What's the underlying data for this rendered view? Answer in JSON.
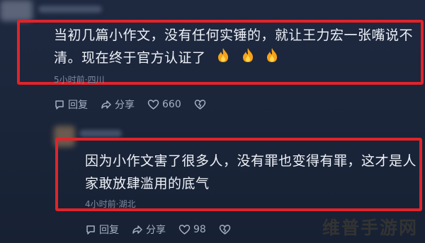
{
  "comments": [
    {
      "line1": "当初几篇小作文，没有任何实锤的，就让王力宏一张嘴说不",
      "line2": "清。现在终于官方认证了",
      "meta": "5小时前·四川",
      "reply_label": "回复",
      "share_label": "分享",
      "like_count": "660"
    },
    {
      "line1": "因为小作文害了很多人，没有罪也变得有罪，这才是人",
      "line2": "家敢放肆滥用的底气",
      "meta": "4小时前·湖北",
      "reply_label": "回复",
      "share_label": "分享",
      "like_count": "98"
    }
  ],
  "watermark": "维普手游网",
  "colors": {
    "highlight": "#e0242a",
    "background": "#1b2536"
  },
  "icons": [
    "reply-icon",
    "share-icon",
    "heart-icon",
    "dislike-icon",
    "fire-emoji-icon"
  ]
}
